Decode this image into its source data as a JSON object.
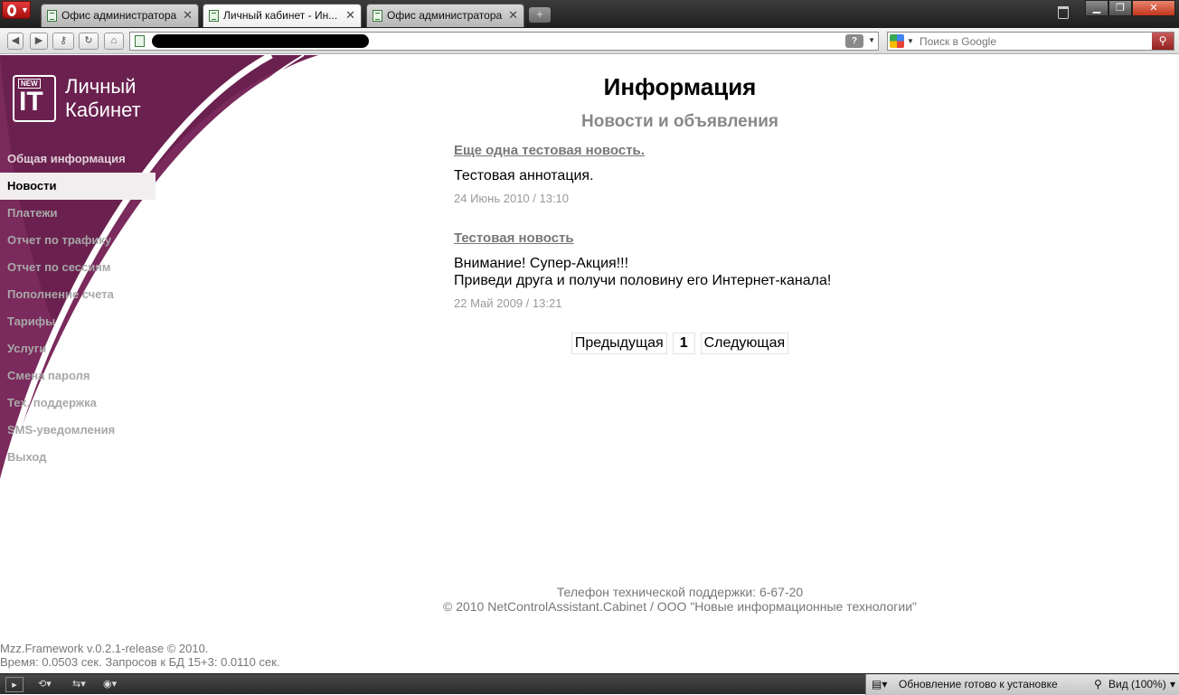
{
  "browser": {
    "tabs": [
      {
        "title": "Офис администратора",
        "active": false
      },
      {
        "title": "Личный кабинет - Ин...",
        "active": true
      },
      {
        "title": "Офис администратора",
        "active": false
      }
    ],
    "tab_close": "✕",
    "new_tab": "+",
    "search_placeholder": "Поиск в Google",
    "status_text": "Обновление готово к установке",
    "zoom": "Вид (100%)"
  },
  "sidebar": {
    "logo_badge": "NEW",
    "logo_mark": "IT",
    "logo_line1": "Личный",
    "logo_line2": "Кабинет",
    "items": [
      {
        "label": "Общая информация"
      },
      {
        "label": "Новости",
        "active": true
      },
      {
        "label": "Платежи"
      },
      {
        "label": "Отчет по трафику"
      },
      {
        "label": "Отчет по сессиям"
      },
      {
        "label": "Пополнение счета"
      },
      {
        "label": "Тарифы"
      },
      {
        "label": "Услуги"
      },
      {
        "label": "Смена пароля"
      },
      {
        "label": "Тех. поддержка"
      },
      {
        "label": "SMS-уведомления"
      },
      {
        "label": "Выход"
      }
    ]
  },
  "main": {
    "title": "Информация",
    "subtitle": "Новости и объявления",
    "news": [
      {
        "title": "Еще одна тестовая новость.",
        "text_lines": [
          "Тестовая аннотация."
        ],
        "date": "24 Июнь 2010 / 13:10"
      },
      {
        "title": "Тестовая новость",
        "text_lines": [
          "Внимание! Супер-Акция!!!",
          "Приведи друга и получи половину его Интернет-канала!"
        ],
        "date": "22 Май 2009 / 13:21"
      }
    ],
    "pager": {
      "prev": "Предыдущая",
      "current": "1",
      "next": "Следующая"
    }
  },
  "footer": {
    "phone": "Телефон технической поддержки: 6-67-20",
    "copyright": "© 2010 NetControlAssistant.Cabinet / ООО \"Новые информационные технологии\"",
    "framework": "Mzz.Framework v.0.2.1-release © 2010.",
    "timing": "Время: 0.0503 сек. Запросов к БД 15+3: 0.0110 сек."
  },
  "colors": {
    "brand": "#7a2a5c",
    "brand_dark": "#5e1a45"
  }
}
